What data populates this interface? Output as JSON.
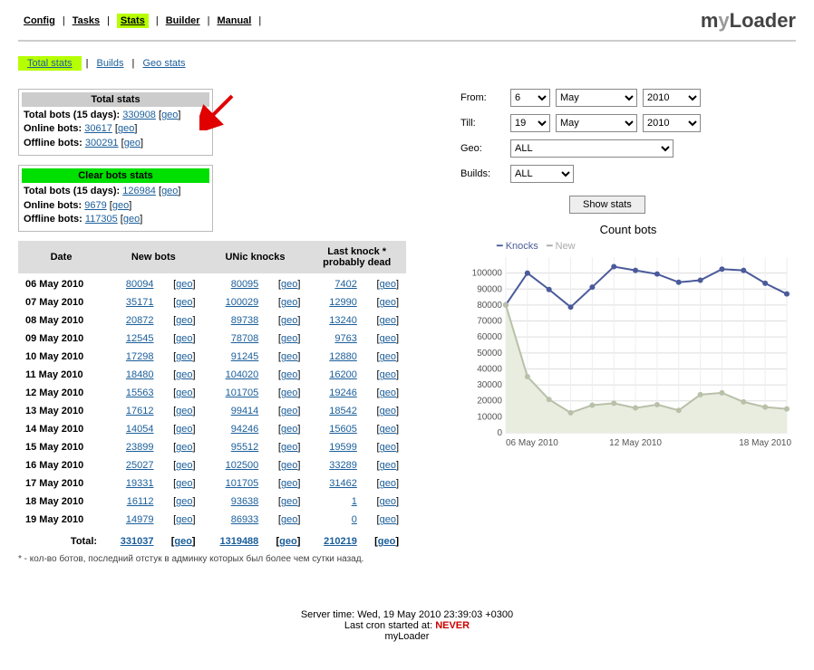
{
  "topnav": {
    "items": [
      "Config",
      "Tasks",
      "Stats",
      "Builder",
      "Manual"
    ],
    "active": "Stats",
    "brand_prefix": "m",
    "brand_mid": "y",
    "brand_suffix": "Loader"
  },
  "subnav": {
    "items": [
      "Total stats",
      "Builds",
      "Geo stats"
    ],
    "active": "Total stats"
  },
  "total_stats": {
    "header": "Total stats",
    "total_label": "Total bots (15 days):",
    "total_value": "330908",
    "online_label": "Online bots:",
    "online_value": "30617",
    "offline_label": "Offline bots:",
    "offline_value": "300291",
    "geo_label": "geo"
  },
  "clear_stats": {
    "header": "Clear bots stats",
    "total_label": "Total bots (15 days):",
    "total_value": "126984",
    "online_label": "Online bots:",
    "online_value": "9679",
    "offline_label": "Offline bots:",
    "offline_value": "117305",
    "geo_label": "geo"
  },
  "table": {
    "headers": {
      "date": "Date",
      "newbots": "New bots",
      "unic": "UNic knocks",
      "lastknock": "Last knock *\nprobably dead"
    },
    "rows": [
      {
        "date": "06 May 2010",
        "newbots": "80094",
        "unic": "80095",
        "lastknock": "7402"
      },
      {
        "date": "07 May 2010",
        "newbots": "35171",
        "unic": "100029",
        "lastknock": "12990"
      },
      {
        "date": "08 May 2010",
        "newbots": "20872",
        "unic": "89738",
        "lastknock": "13240"
      },
      {
        "date": "09 May 2010",
        "newbots": "12545",
        "unic": "78708",
        "lastknock": "9763"
      },
      {
        "date": "10 May 2010",
        "newbots": "17298",
        "unic": "91245",
        "lastknock": "12880"
      },
      {
        "date": "11 May 2010",
        "newbots": "18480",
        "unic": "104020",
        "lastknock": "16200"
      },
      {
        "date": "12 May 2010",
        "newbots": "15563",
        "unic": "101705",
        "lastknock": "19246"
      },
      {
        "date": "13 May 2010",
        "newbots": "17612",
        "unic": "99414",
        "lastknock": "18542"
      },
      {
        "date": "14 May 2010",
        "newbots": "14054",
        "unic": "94246",
        "lastknock": "15605"
      },
      {
        "date": "15 May 2010",
        "newbots": "23899",
        "unic": "95512",
        "lastknock": "19599"
      },
      {
        "date": "16 May 2010",
        "newbots": "25027",
        "unic": "102500",
        "lastknock": "33289"
      },
      {
        "date": "17 May 2010",
        "newbots": "19331",
        "unic": "101705",
        "lastknock": "31462"
      },
      {
        "date": "18 May 2010",
        "newbots": "16112",
        "unic": "93638",
        "lastknock": "1"
      },
      {
        "date": "19 May 2010",
        "newbots": "14979",
        "unic": "86933",
        "lastknock": "0"
      }
    ],
    "total": {
      "label": "Total:",
      "newbots": "331037",
      "unic": "1319488",
      "lastknock": "210219"
    },
    "geo_label": "geo"
  },
  "footnote": "* - кол-во ботов, последний отстук в админку которых был более чем сутки назад.",
  "filters": {
    "from_label": "From:",
    "from_day": "6",
    "from_month": "May",
    "from_year": "2010",
    "till_label": "Till:",
    "till_day": "19",
    "till_month": "May",
    "till_year": "2010",
    "geo_label": "Geo:",
    "geo_value": "ALL",
    "builds_label": "Builds:",
    "builds_value": "ALL",
    "show_stats": "Show stats"
  },
  "chart_data": {
    "type": "line",
    "title": "Count bots",
    "legend": [
      "Knocks",
      "New"
    ],
    "x": [
      "06 May 2010",
      "07 May 2010",
      "08 May 2010",
      "09 May 2010",
      "10 May 2010",
      "11 May 2010",
      "12 May 2010",
      "13 May 2010",
      "14 May 2010",
      "15 May 2010",
      "16 May 2010",
      "17 May 2010",
      "18 May 2010",
      "19 May 2010"
    ],
    "series": [
      {
        "name": "Knocks",
        "values": [
          80095,
          100029,
          89738,
          78708,
          91245,
          104020,
          101705,
          99414,
          94246,
          95512,
          102500,
          101705,
          93638,
          86933
        ]
      },
      {
        "name": "New",
        "values": [
          80094,
          35171,
          20872,
          12545,
          17298,
          18480,
          15563,
          17612,
          14054,
          23899,
          25027,
          19331,
          16112,
          14979
        ]
      }
    ],
    "ylim": [
      0,
      110000
    ],
    "yticks": [
      0,
      10000,
      20000,
      30000,
      40000,
      50000,
      60000,
      70000,
      80000,
      90000,
      100000
    ],
    "xticks": [
      "06 May 2010",
      "12 May 2010",
      "18 May 2010"
    ]
  },
  "footer": {
    "server_time": "Server time: Wed, 19 May 2010 23:39:03 +0300",
    "cron_label": "Last cron started at: ",
    "cron_value": "NEVER",
    "brand": "myLoader"
  }
}
